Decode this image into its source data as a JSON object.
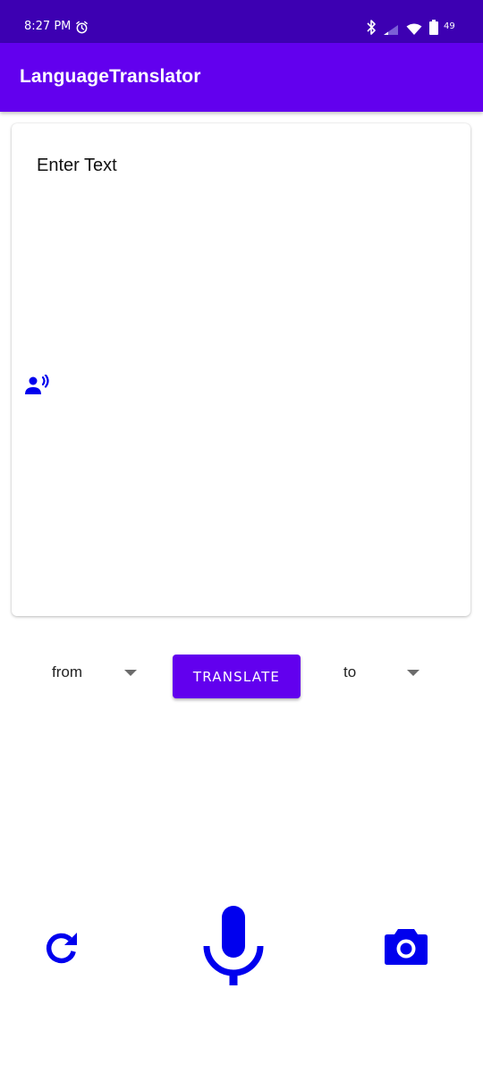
{
  "status_bar": {
    "time": "8:27 PM",
    "battery_level": "49",
    "icons": [
      "alarm-icon",
      "bluetooth-icon",
      "cell-signal-icon",
      "wifi-icon",
      "battery-icon"
    ]
  },
  "app_bar": {
    "title": "LanguageTranslator"
  },
  "input_card": {
    "text_value": "",
    "placeholder": "Enter Text",
    "speak_icon": "record-voice-icon"
  },
  "controls": {
    "from_label": "from",
    "to_label": "to",
    "translate_label": "TRANSLATE"
  },
  "bottom_actions": {
    "refresh_icon": "refresh-icon",
    "mic_icon": "microphone-icon",
    "camera_icon": "camera-icon"
  },
  "colors": {
    "status_bar": "#3d00b2",
    "primary": "#6200ee",
    "icon_accent": "#0000ee",
    "background": "#ffffff"
  }
}
